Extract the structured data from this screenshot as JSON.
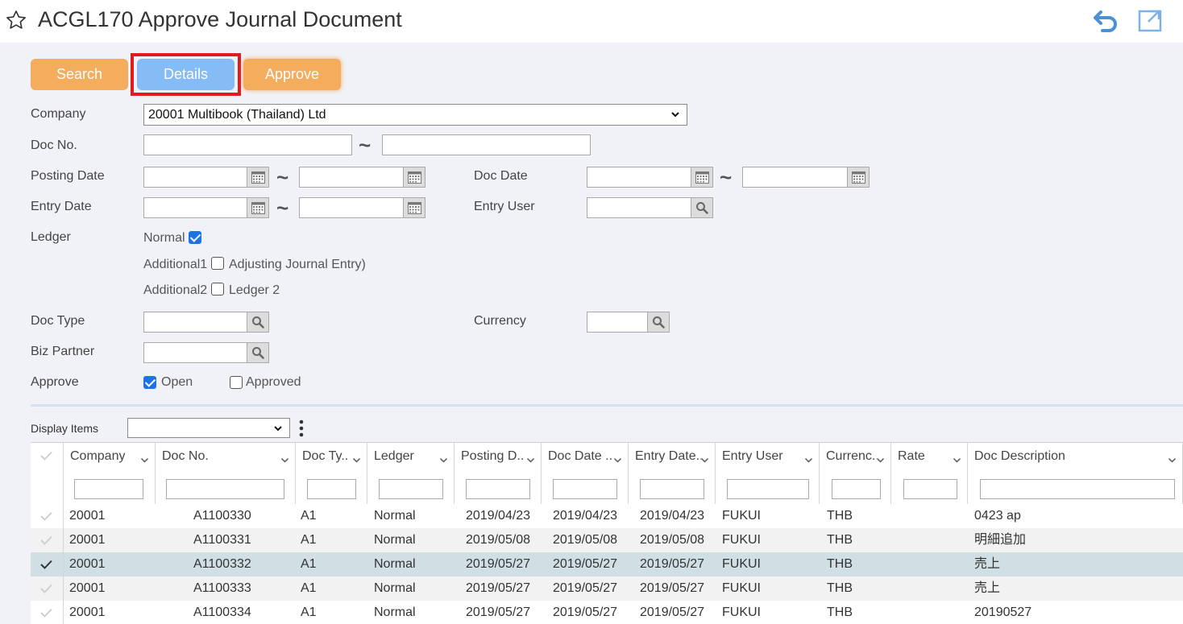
{
  "header": {
    "title": "ACGL170 Approve Journal Document",
    "icons": [
      "star-icon",
      "return-icon",
      "popout-icon"
    ]
  },
  "toolbar": {
    "search_label": "Search",
    "details_label": "Details",
    "approve_label": "Approve"
  },
  "form": {
    "company_label": "Company",
    "company_value": "20001 Multibook (Thailand) Ltd",
    "docno_label": "Doc No.",
    "posting_date_label": "Posting Date",
    "doc_date_label": "Doc Date",
    "entry_date_label": "Entry Date",
    "entry_user_label": "Entry User",
    "ledger_label": "Ledger",
    "ledger_normal": "Normal",
    "ledger_additional1": "Additional1",
    "ledger_additional1_desc": "Adjusting Journal Entry)",
    "ledger_additional2": "Additional2",
    "ledger_additional2_desc": "Ledger 2",
    "doc_type_label": "Doc Type",
    "currency_label": "Currency",
    "biz_partner_label": "Biz Partner",
    "approve_label": "Approve",
    "approve_open": "Open",
    "approve_approved": "Approved",
    "range_separator": "~"
  },
  "states": {
    "ledger_normal_checked": true,
    "ledger_additional1_checked": false,
    "ledger_additional2_checked": false,
    "approve_open_checked": true,
    "approve_approved_checked": false
  },
  "display_items": {
    "label": "Display Items",
    "value": ""
  },
  "grid": {
    "columns": [
      "Company",
      "Doc No.",
      "Doc Ty..",
      "Ledger",
      "Posting D..",
      "Doc Date ..",
      "Entry Date..",
      "Entry User",
      "Currenc..",
      "Rate",
      "Doc Description"
    ],
    "rows": [
      {
        "company": "20001",
        "doc_no": "A1100330",
        "doc_type": "A1",
        "ledger": "Normal",
        "posting_date": "2019/04/23",
        "doc_date": "2019/04/23",
        "entry_date": "2019/04/23",
        "entry_user": "FUKUI",
        "currency": "THB",
        "rate": "",
        "description": "0423 ap",
        "selected": false
      },
      {
        "company": "20001",
        "doc_no": "A1100331",
        "doc_type": "A1",
        "ledger": "Normal",
        "posting_date": "2019/05/08",
        "doc_date": "2019/05/08",
        "entry_date": "2019/05/08",
        "entry_user": "FUKUI",
        "currency": "THB",
        "rate": "",
        "description": "明細追加",
        "selected": false
      },
      {
        "company": "20001",
        "doc_no": "A1100332",
        "doc_type": "A1",
        "ledger": "Normal",
        "posting_date": "2019/05/27",
        "doc_date": "2019/05/27",
        "entry_date": "2019/05/27",
        "entry_user": "FUKUI",
        "currency": "THB",
        "rate": "",
        "description": "売上",
        "selected": true
      },
      {
        "company": "20001",
        "doc_no": "A1100333",
        "doc_type": "A1",
        "ledger": "Normal",
        "posting_date": "2019/05/27",
        "doc_date": "2019/05/27",
        "entry_date": "2019/05/27",
        "entry_user": "FUKUI",
        "currency": "THB",
        "rate": "",
        "description": "売上",
        "selected": false
      },
      {
        "company": "20001",
        "doc_no": "A1100334",
        "doc_type": "A1",
        "ledger": "Normal",
        "posting_date": "2019/05/27",
        "doc_date": "2019/05/27",
        "entry_date": "2019/05/27",
        "entry_user": "FUKUI",
        "currency": "THB",
        "rate": "",
        "description": "20190527",
        "selected": false
      }
    ]
  },
  "colors": {
    "orange_button": "#f3ad5c",
    "blue_button": "#86bcf5",
    "highlight": "#e11b22",
    "selected_row": "#cfdfe3"
  }
}
